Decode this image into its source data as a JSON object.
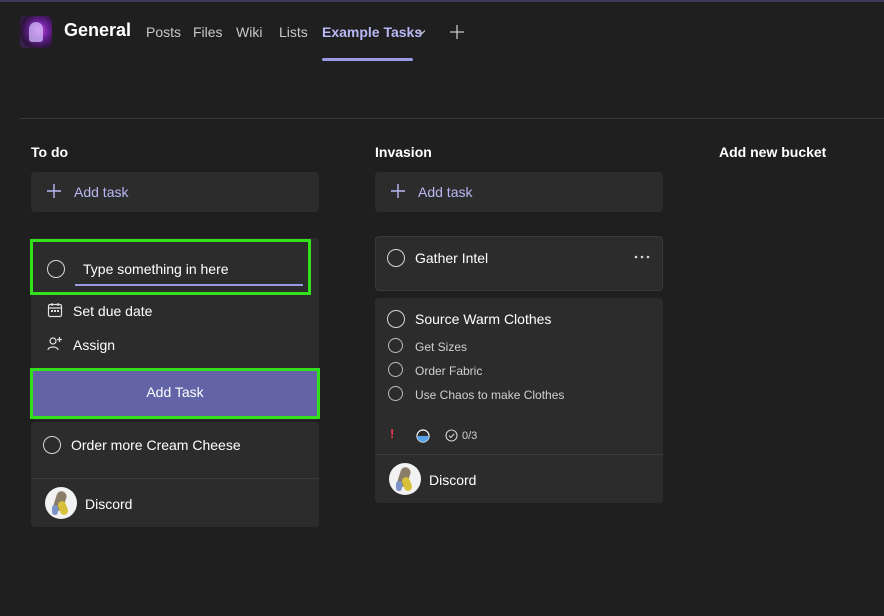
{
  "header": {
    "team_name": "General",
    "tabs": [
      {
        "label": "Posts"
      },
      {
        "label": "Files"
      },
      {
        "label": "Wiki"
      },
      {
        "label": "Lists"
      },
      {
        "label": "Example Tasks"
      }
    ],
    "active_tab_index": 4
  },
  "buckets": [
    {
      "title": "To do",
      "add_task_label": "Add task",
      "new_task_form": {
        "input_placeholder": "Type something in here",
        "set_due_date_label": "Set due date",
        "assign_label": "Assign",
        "submit_label": "Add Task"
      },
      "tasks": [
        {
          "title": "Order more Cream Cheese",
          "assignee": "Discord"
        }
      ]
    },
    {
      "title": "Invasion",
      "add_task_label": "Add task",
      "tasks": [
        {
          "title": "Gather Intel"
        },
        {
          "title": "Source Warm Clothes",
          "checklist": [
            "Get Sizes",
            "Order Fabric",
            "Use Chaos to make Clothes"
          ],
          "priority_marker": "!",
          "checklist_progress": "0/3",
          "assignee": "Discord"
        }
      ]
    }
  ],
  "add_new_bucket_label": "Add new bucket",
  "colors": {
    "accent": "#6264a7",
    "accent_text": "#b9b8f5",
    "highlight_outline": "#32e01b",
    "priority": "#e8384f",
    "card_bg": "#2d2c2c",
    "page_bg": "#1f1f1f"
  }
}
